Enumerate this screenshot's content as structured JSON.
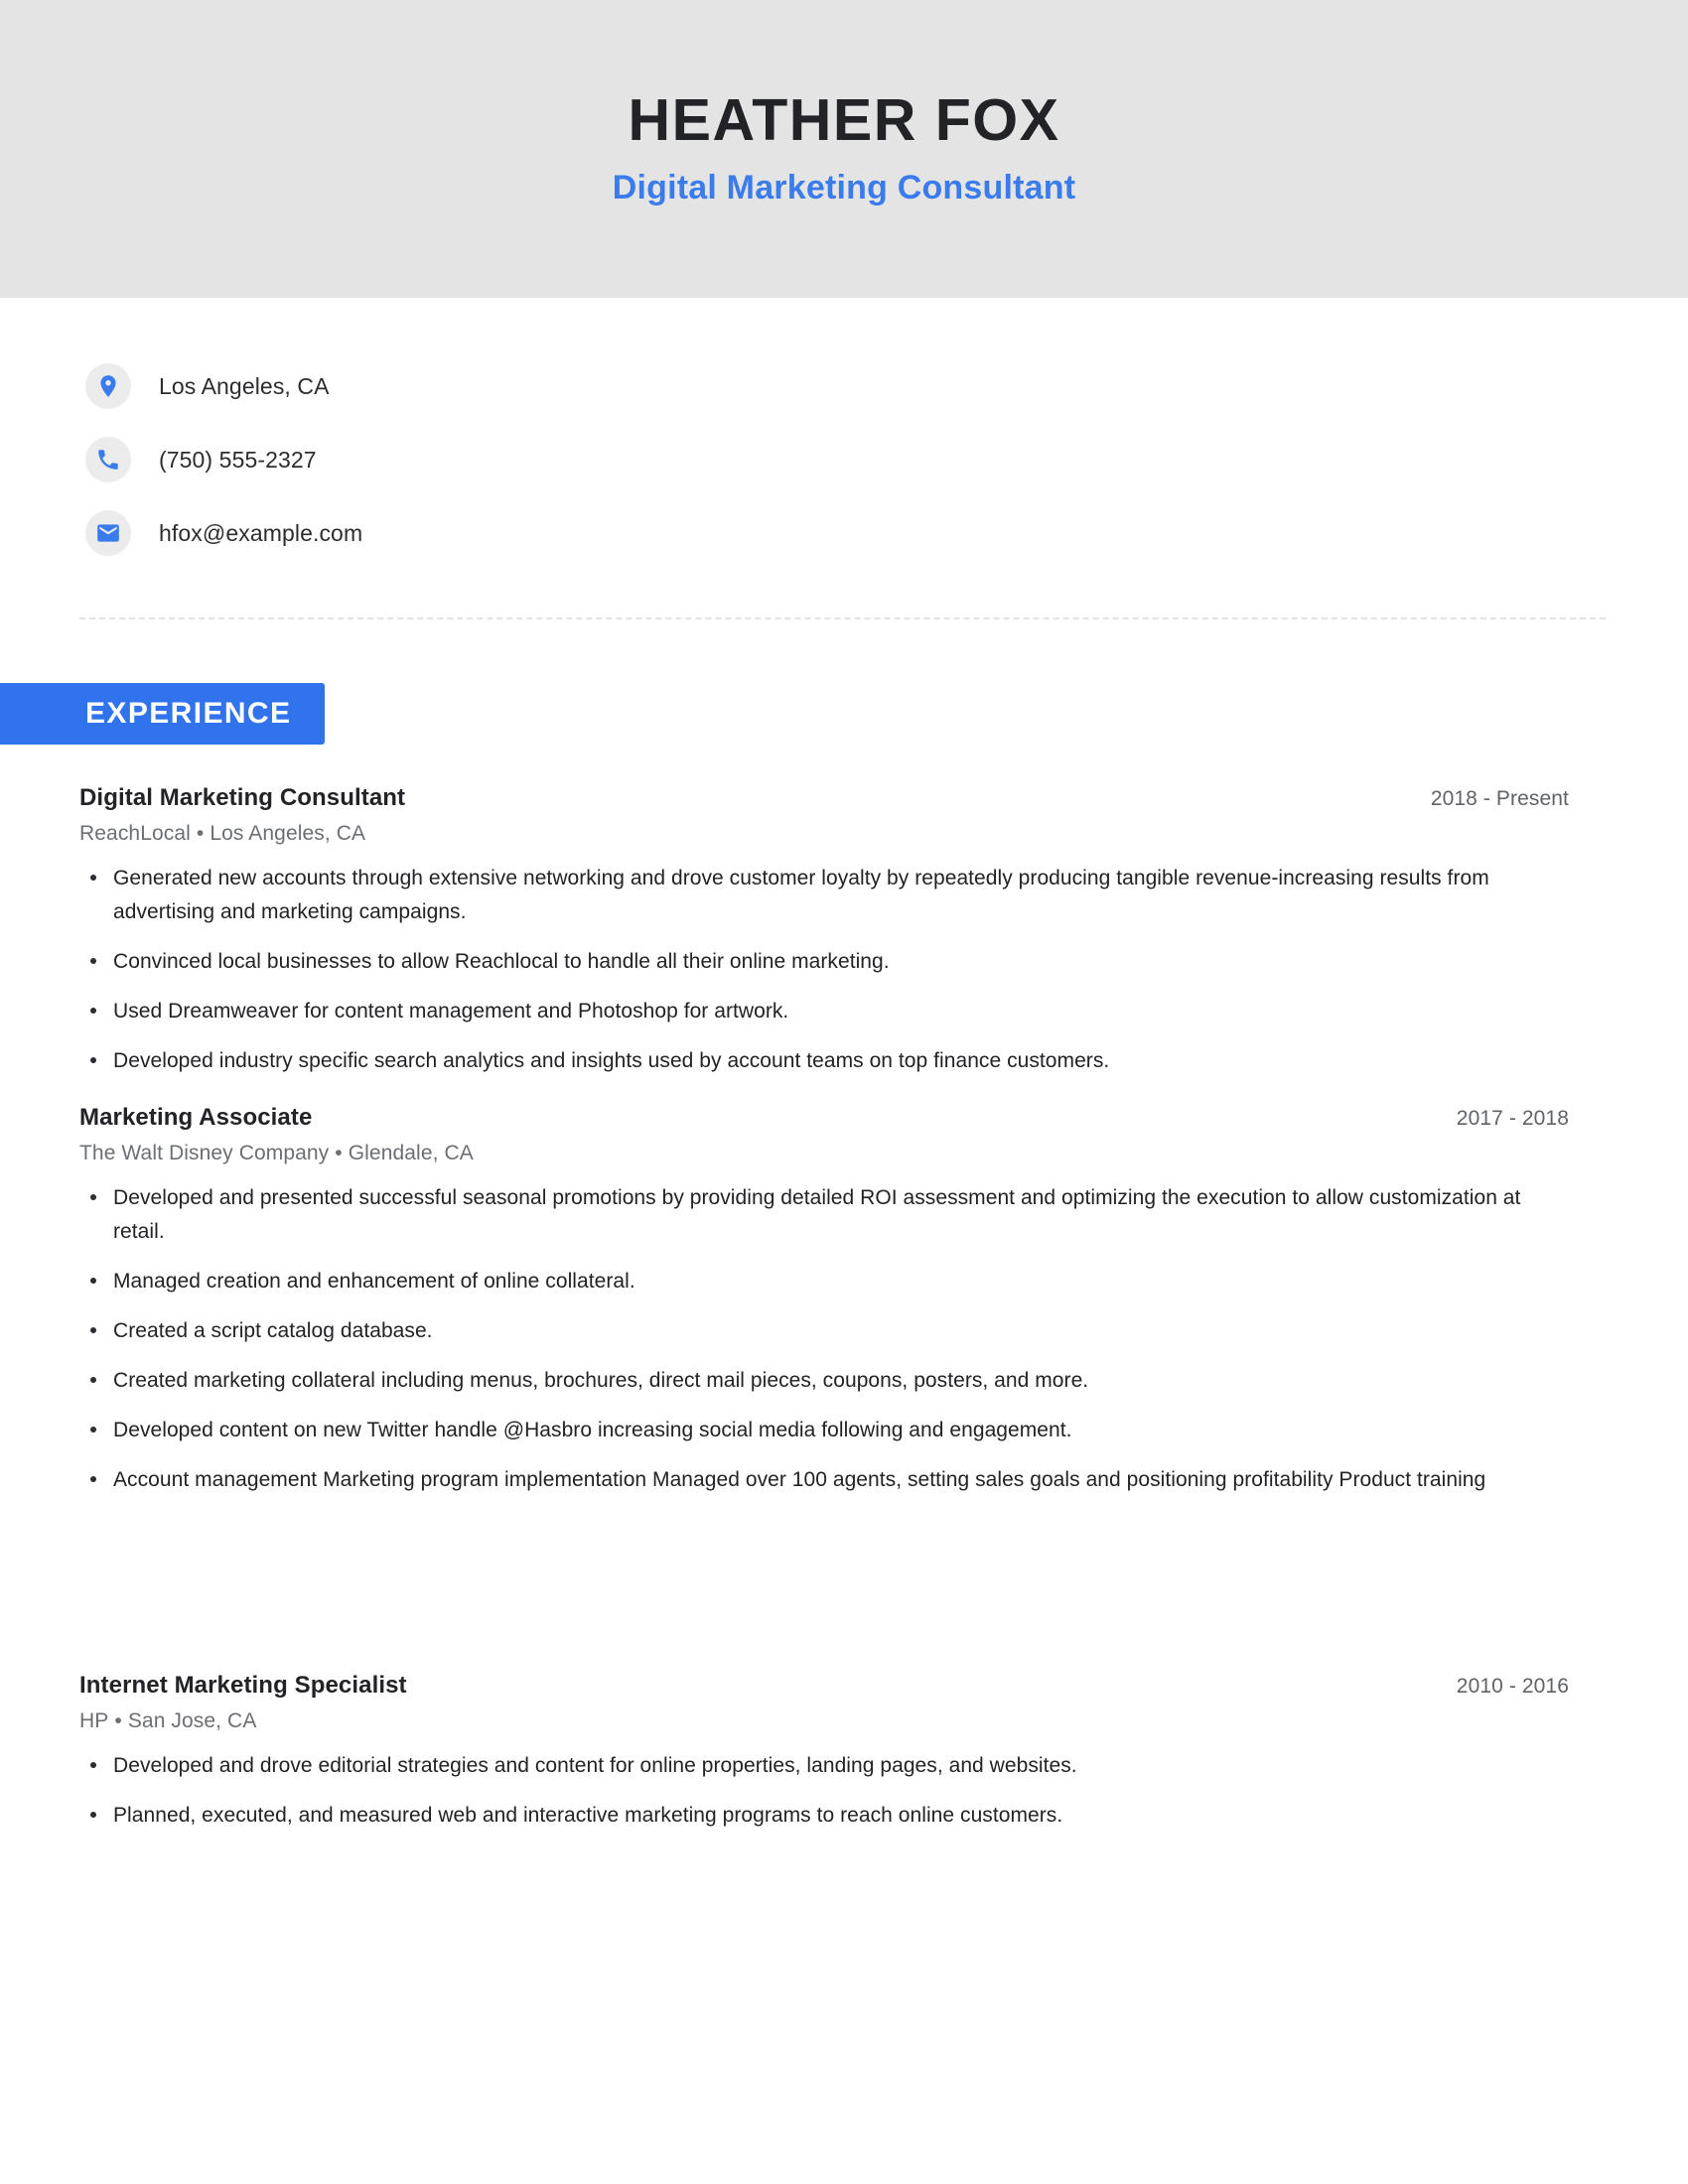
{
  "header": {
    "name": "HEATHER FOX",
    "title": "Digital Marketing Consultant",
    "band_color": "#e4e4e4",
    "accent_color": "#3b7ced"
  },
  "contact": {
    "items": [
      {
        "icon": "location-pin-icon",
        "value": "Los Angeles, CA"
      },
      {
        "icon": "phone-icon",
        "value": "(750) 555-2327"
      },
      {
        "icon": "email-icon",
        "value": "hfox@example.com"
      }
    ]
  },
  "sections": {
    "experience": {
      "heading": "EXPERIENCE",
      "banner_color": "#3173ed",
      "entries": [
        {
          "role": "Digital Marketing Consultant",
          "dates": "2018 - Present",
          "company": "ReachLocal",
          "separator": "•",
          "location": "Los Angeles, CA",
          "bullets": [
            "Generated new accounts through extensive networking and drove customer loyalty by repeatedly producing tangible revenue-increasing results from advertising and marketing campaigns.",
            "Convinced local businesses to allow Reachlocal to handle all their online marketing.",
            "Used Dreamweaver for content management and Photoshop for artwork.",
            "Developed industry specific search analytics and insights used by account teams on top finance customers."
          ]
        },
        {
          "role": "Marketing Associate",
          "dates": "2017 - 2018",
          "company": "The Walt Disney Company",
          "separator": "•",
          "location": "Glendale, CA",
          "bullets": [
            "Developed and presented successful seasonal promotions by providing detailed ROI assessment and optimizing the execution to allow customization at retail.",
            "Managed creation and enhancement of online collateral.",
            "Created a script catalog database.",
            "Created marketing collateral including menus, brochures, direct mail pieces, coupons, posters, and more.",
            "Developed content on new Twitter handle @Hasbro increasing social media following and engagement.",
            "Account management Marketing program implementation Managed over 100 agents, setting sales goals and positioning profitability Product training"
          ]
        },
        {
          "role": "Internet Marketing Specialist",
          "dates": "2010 - 2016",
          "company": "HP",
          "separator": "•",
          "location": "San Jose, CA",
          "bullets": [
            "Developed and drove editorial strategies and content for online properties, landing pages, and websites.",
            "Planned, executed, and measured web and interactive marketing programs to reach online customers."
          ]
        }
      ]
    }
  }
}
